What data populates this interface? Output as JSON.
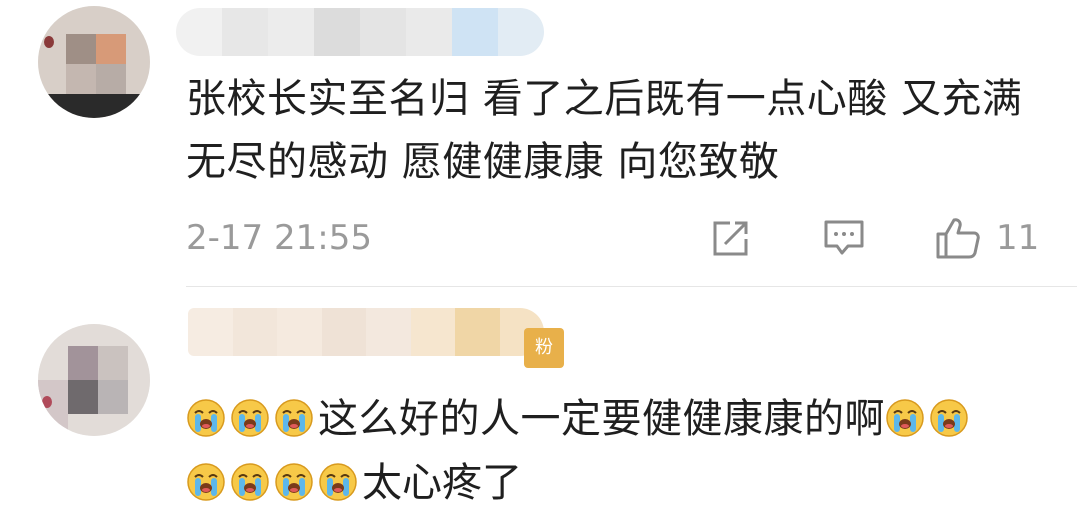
{
  "comments": [
    {
      "text": "张校长实至名归 看了之后既有一点心酸 又充满无尽的感动 愿健健康康 向您致敬",
      "time": "2-17 21:55",
      "likes": "11",
      "icons": [
        "share-icon",
        "comment-icon",
        "like-icon"
      ]
    },
    {
      "emoji_prefix_count": 3,
      "text": "这么好的人一定要健健康康的啊",
      "emoji_suffix_count": 2,
      "badge": "粉",
      "line2_emoji_count": 4,
      "line2_text": "太心疼了"
    }
  ],
  "colors": {
    "text": "#1f1f1f",
    "meta": "#9a9a9a",
    "divider": "#e6e6e6",
    "badge": "#e8b04a"
  }
}
